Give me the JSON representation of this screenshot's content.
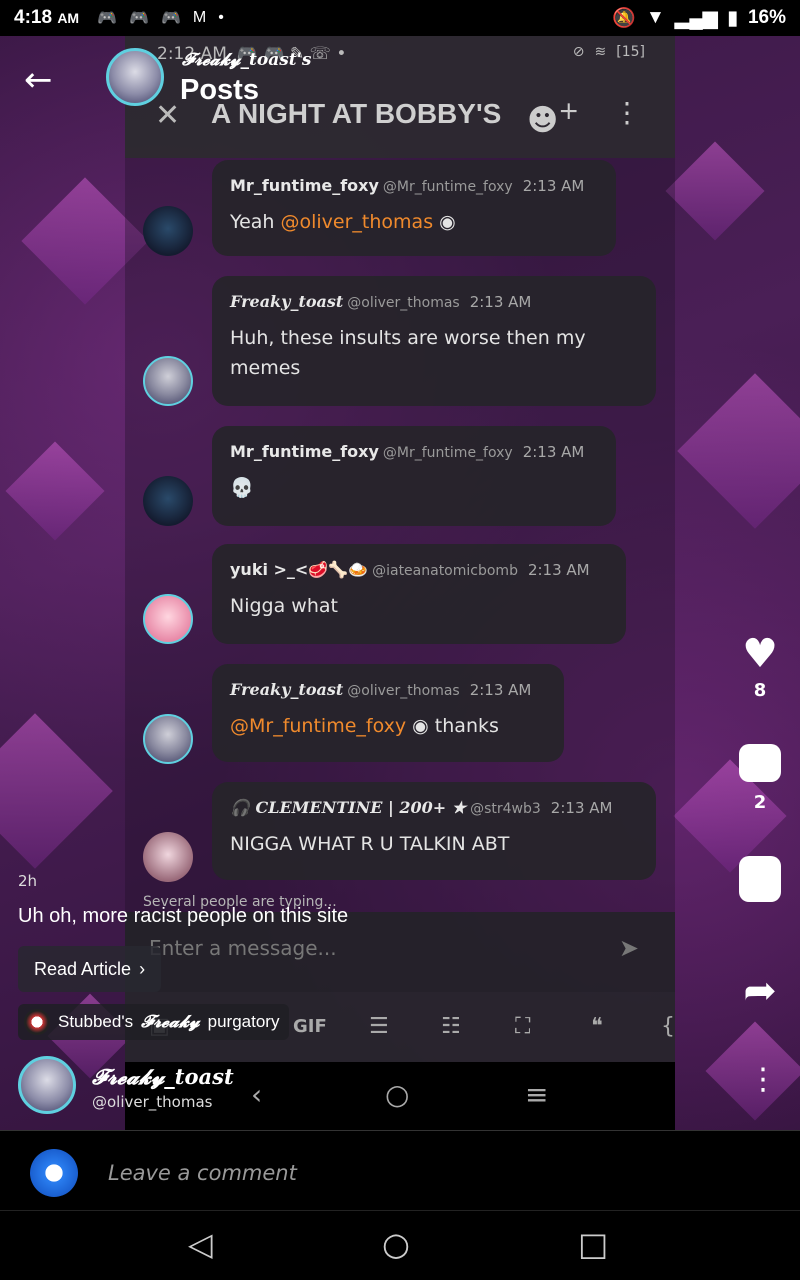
{
  "status_bar": {
    "time": "4:18",
    "ampm": "AM",
    "battery": "16%",
    "notif_icons": [
      "discord-icon",
      "discord-icon",
      "discord-icon",
      "gmail-icon"
    ]
  },
  "header": {
    "owner": "𝓕𝓻𝓮𝓪𝓴𝔂_toast's",
    "title": "Posts"
  },
  "embedded_chat": {
    "status_time": "2:12 AM",
    "battery": "15",
    "title": "A NIGHT AT BOBBY'S",
    "messages": [
      {
        "name": "Mr_funtime_foxy",
        "handle": "@Mr_funtime_foxy",
        "time": "2:13 AM",
        "text_prefix": "Yeah ",
        "mention": "@oliver_thomas",
        "text_suffix": ""
      },
      {
        "name": "Freaky_toast",
        "handle": "@oliver_thomas",
        "time": "2:13 AM",
        "text": "Huh, these insults are worse then my memes"
      },
      {
        "name": "Mr_funtime_foxy",
        "handle": "@Mr_funtime_foxy",
        "time": "2:13 AM",
        "text": "💀"
      },
      {
        "name": "yuki >_<🥩🦴🍛",
        "handle": "@iateanatomicbomb",
        "time": "2:13 AM",
        "text": "Nigga what"
      },
      {
        "name": "Freaky_toast",
        "handle": "@oliver_thomas",
        "time": "2:13 AM",
        "mention": "@Mr_funtime_foxy",
        "text_suffix": " thanks"
      },
      {
        "name": "🎧 CLEMENTINE | 200+ ★",
        "handle": "@str4wb3",
        "time": "2:13 AM",
        "text": "NIGGA WHAT R U TALKIN ABT"
      }
    ],
    "typing": "Several people are typing...",
    "input_placeholder": "Enter a message..."
  },
  "side_actions": {
    "likes": "8",
    "comments": "2"
  },
  "post": {
    "age": "2h",
    "caption": "Uh oh, more racist people on this site",
    "read_article": "Read Article",
    "community_owner": "Stubbed's",
    "community_name": "purgatory",
    "community_mid": "𝓕𝓻𝓮𝓪𝓴𝔂",
    "author_name": "𝓕𝓻𝓮𝓪𝓴𝔂_toast",
    "author_handle": "@oliver_thomas"
  },
  "comment": {
    "placeholder": "Leave a comment"
  }
}
